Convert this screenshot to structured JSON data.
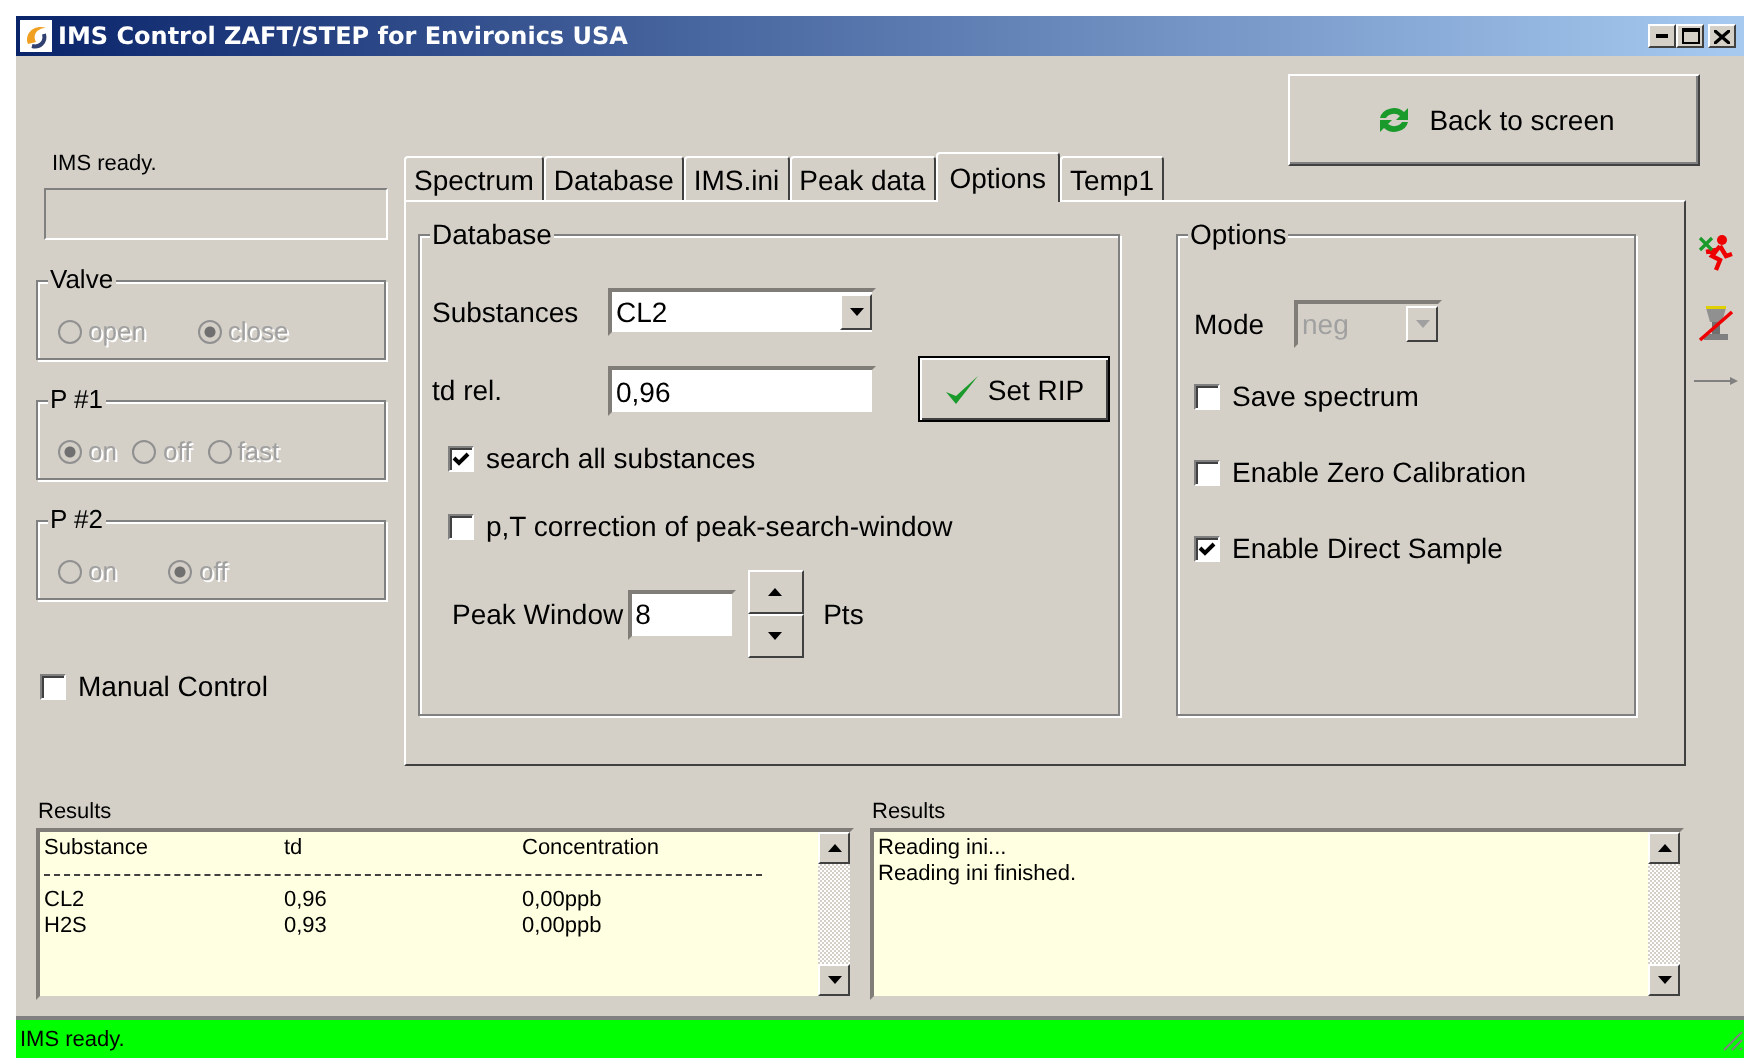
{
  "window": {
    "title": "IMS Control ZAFT/STEP for Environics USA"
  },
  "status_label": "IMS ready.",
  "groups": [
    {
      "legend": "Valve",
      "disabled": true,
      "options": [
        {
          "label": "open",
          "selected": false
        },
        {
          "label": "close",
          "selected": true
        }
      ]
    },
    {
      "legend": "P #1",
      "disabled": true,
      "options": [
        {
          "label": "on",
          "selected": true
        },
        {
          "label": "off",
          "selected": false
        },
        {
          "label": "fast",
          "selected": false
        }
      ]
    },
    {
      "legend": "P #2",
      "disabled": true,
      "options": [
        {
          "label": "on",
          "selected": false
        },
        {
          "label": "off",
          "selected": true
        }
      ]
    }
  ],
  "manual_control": {
    "label": "Manual Control",
    "checked": false
  },
  "back_button": "Back to screen",
  "tabs": [
    {
      "label": "Spectrum",
      "selected": false
    },
    {
      "label": "Database",
      "selected": false
    },
    {
      "label": "IMS.ini",
      "selected": false
    },
    {
      "label": "Peak data",
      "selected": false
    },
    {
      "label": "Options",
      "selected": true
    },
    {
      "label": "Temp1",
      "selected": false
    }
  ],
  "database": {
    "legend": "Database",
    "substances": {
      "label": "Substances",
      "value": "CL2"
    },
    "td_rel": {
      "label": "td rel.",
      "value": "0,96"
    },
    "set_rip": "Set RIP",
    "checkboxes": [
      {
        "label": "search all substances",
        "checked": true
      },
      {
        "label": "p,T correction of peak-search-window",
        "checked": false
      }
    ],
    "peak_window": {
      "label": "Peak Window",
      "value": "8",
      "unit": "Pts"
    }
  },
  "options": {
    "legend": "Options",
    "mode": {
      "label": "Mode",
      "value": "neg",
      "disabled": true
    },
    "checkboxes": [
      {
        "label": "Save spectrum",
        "checked": false
      },
      {
        "label": "Enable Zero Calibration",
        "checked": false
      },
      {
        "label": "Enable Direct Sample",
        "checked": true
      }
    ]
  },
  "results": [
    {
      "kind": "table",
      "title": "Results",
      "columns": [
        "Substance",
        "td",
        "Concentration"
      ],
      "rows": [
        [
          "CL2",
          "0,96",
          "0,00ppb"
        ],
        [
          "H2S",
          "0,93",
          "0,00ppb"
        ]
      ]
    },
    {
      "kind": "log",
      "title": "Results",
      "lines": [
        "Reading ini...",
        "Reading ini finished."
      ]
    }
  ],
  "status_bar": {
    "text": "IMS ready."
  }
}
